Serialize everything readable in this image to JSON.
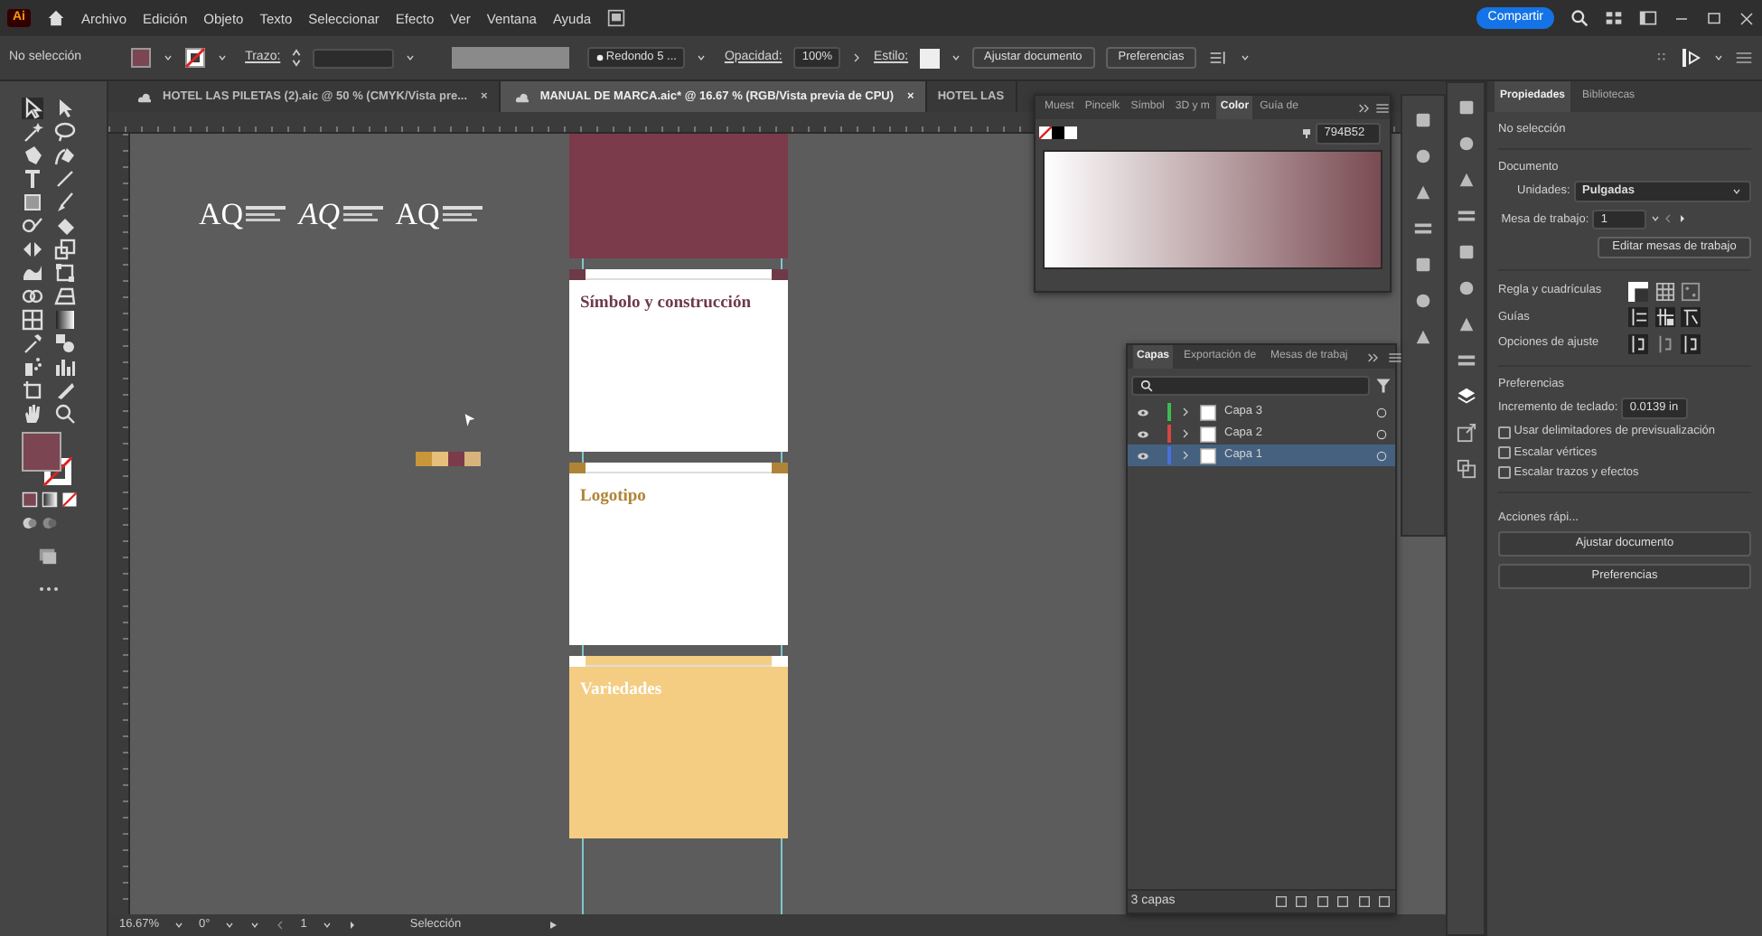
{
  "app": {
    "logo": "Ai"
  },
  "menubar": {
    "menus": [
      "Archivo",
      "Edición",
      "Objeto",
      "Texto",
      "Seleccionar",
      "Efecto",
      "Ver",
      "Ventana",
      "Ayuda"
    ],
    "share_button": "Compartir"
  },
  "control_bar": {
    "selection": "No selección",
    "stroke_label": "Trazo:",
    "brush": "Redondo 5 ...",
    "opacity_label": "Opacidad:",
    "opacity": "100%",
    "style_label": "Estilo:",
    "buttons": [
      "Ajustar documento",
      "Preferencias"
    ]
  },
  "doc_tabs": [
    {
      "label": "HOTEL LAS PILETAS (2).aic @ 50 % (CMYK/Vista pre...",
      "close": "×",
      "selected": false
    },
    {
      "label": "MANUAL DE MARCA.aic* @ 16.67 % (RGB/Vista previa de CPU)",
      "close": "×",
      "selected": true
    },
    {
      "label": "HOTEL LAS",
      "selected": false
    }
  ],
  "toolbar": {
    "fill": {
      "color": "#7b4552"
    }
  },
  "canvas": {
    "logos": [
      {
        "text": "AQ",
        "kind": "upright"
      },
      {
        "text": "AQ",
        "kind": "italic"
      },
      {
        "text": "AQ",
        "kind": "upright"
      }
    ],
    "swatches": [
      {
        "color": "#c9963a"
      },
      {
        "color": "#e6c07a"
      },
      {
        "color": "#7b3b4b"
      },
      {
        "color": "#d8b47c"
      }
    ],
    "artboards": [
      {
        "kind": "filled",
        "color": "#7b3b4b"
      },
      {
        "kind": "light",
        "title": "Símbolo y construcción",
        "color": "#6e3a48"
      },
      {
        "kind": "light",
        "title": "Logotipo",
        "color": "#b08437"
      },
      {
        "kind": "filled",
        "title": "Variedades",
        "color": "#f4cd83"
      }
    ]
  },
  "color_panel": {
    "tabs": [
      {
        "label": "Muest",
        "selected": false
      },
      {
        "label": "Pincelk",
        "selected": false
      },
      {
        "label": "Símbol",
        "selected": false
      },
      {
        "label": "3D y m",
        "selected": false
      },
      {
        "label": "Color",
        "selected": true
      },
      {
        "label": "Guía de",
        "selected": false
      }
    ],
    "hex": "794B52",
    "color": "#794b52"
  },
  "layers_panel": {
    "tabs": [
      {
        "label": "Capas",
        "selected": true
      },
      {
        "label": "Exportación de",
        "selected": false
      },
      {
        "label": "Mesas de trabaj",
        "selected": false
      }
    ],
    "layers": [
      {
        "name": "Capa 3",
        "color": "#3dbb4e",
        "selected": false
      },
      {
        "name": "Capa 2",
        "color": "#d64545",
        "selected": false
      },
      {
        "name": "Capa 1",
        "color": "#4a6fe0",
        "selected": true
      }
    ],
    "footer": "3 capas"
  },
  "properties": {
    "tabs": [
      {
        "label": "Propiedades",
        "selected": true
      },
      {
        "label": "Bibliotecas",
        "selected": false
      }
    ],
    "selection": "No selección",
    "document_heading": "Documento",
    "units_label": "Unidades:",
    "units": "Pulgadas",
    "artboard_label": "Mesa de trabajo:",
    "artboard": "1",
    "edit_button": "Editar mesas de trabajo",
    "ruler_label": "Regla y cuadrículas",
    "guides_label": "Guías",
    "snap_label": "Opciones de ajuste",
    "preferences_heading": "Preferencias",
    "increment_label": "Incremento de teclado:",
    "increment": "0.0139 in",
    "checkboxes": [
      {
        "label": "Usar delimitadores de previsualización",
        "checked": false
      },
      {
        "label": "Escalar vértices",
        "checked": false
      },
      {
        "label": "Escalar trazos y efectos",
        "checked": false
      }
    ],
    "quick_actions_heading": "Acciones rápi...",
    "buttons": [
      "Ajustar documento",
      "Preferencias"
    ]
  },
  "status_bar": {
    "zoom": "16.67%",
    "rotation": "0°",
    "artboard": "1",
    "tool": "Selección"
  }
}
